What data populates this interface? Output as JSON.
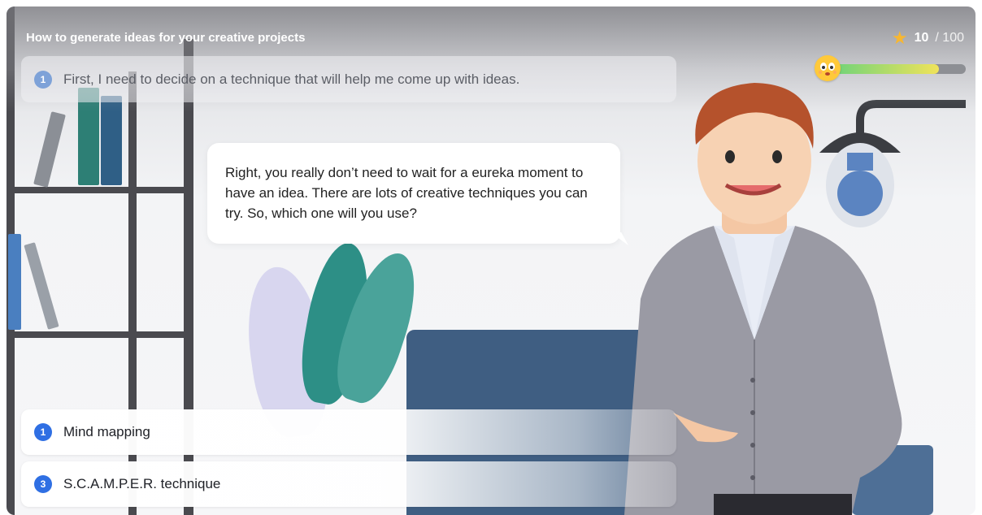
{
  "header": {
    "title": "How to generate ideas for your creative projects",
    "score_value": "10",
    "score_total": "/ 100",
    "progress_fraction": 0.8
  },
  "step": {
    "number": "1",
    "text": "First, I need to decide on a technique that will help me come up with ideas."
  },
  "dialogue": {
    "text": "Right, you really don’t need to wait for a eureka moment to have an idea. There are lots of creative techniques you can try. So, which one will you use?"
  },
  "options": [
    {
      "number": "1",
      "label": "Mind mapping"
    },
    {
      "number": "3",
      "label": "S.C.A.M.P.E.R. technique"
    }
  ],
  "icons": {
    "score": "star-icon",
    "mood": "smiley-face-icon"
  },
  "colors": {
    "accent": "#2f6fe3",
    "star": "#f7b731",
    "sofa": "#3f5e82",
    "plant": "#2d8f86"
  }
}
